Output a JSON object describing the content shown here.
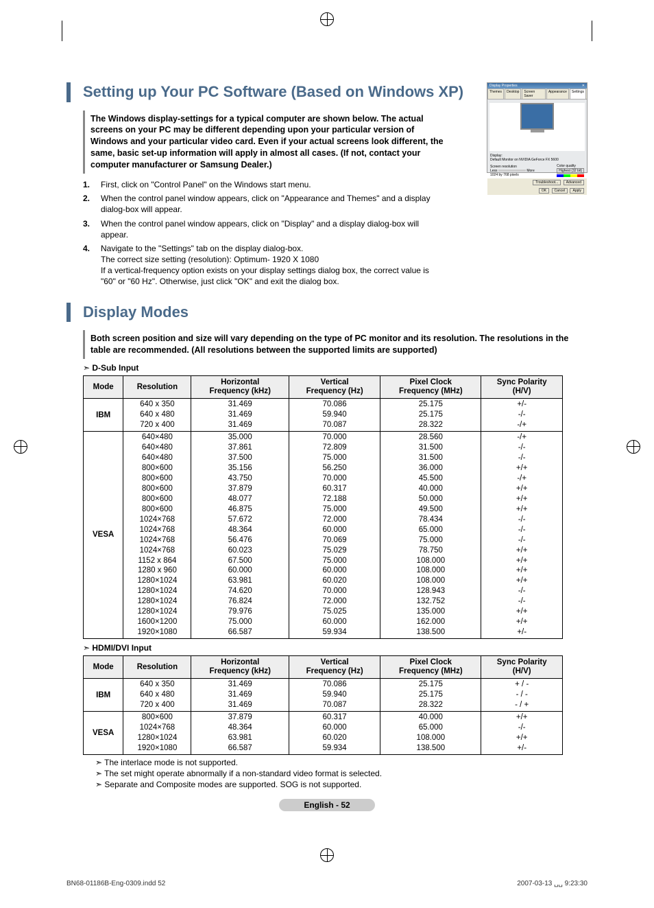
{
  "section1": {
    "title": "Setting up Your PC Software (Based on Windows XP)",
    "lead": "The Windows display-settings for a typical computer are shown below. The actual screens on your PC may be different depending upon your particular version of Windows and your particular video card. Even if your actual screens look different, the same, basic set-up information will apply in almost all cases. (If not, contact your computer manufacturer or Samsung Dealer.)",
    "steps": [
      "First, click on \"Control Panel\" on the Windows start menu.",
      "When the control panel window appears, click on \"Appearance and Themes\" and a display dialog-box will appear.",
      "When the control panel window appears, click on \"Display\" and a display dialog-box will appear.",
      "Navigate to the \"Settings\" tab on the display dialog-box.\nThe correct size setting (resolution): Optimum- 1920 X 1080\nIf a vertical-frequency option exists on your display settings dialog box, the correct value is \"60\" or \"60 Hz\". Otherwise, just click \"OK\" and exit the dialog box."
    ],
    "dialog": {
      "title": "Display Properties",
      "tabs": [
        "Themes",
        "Desktop",
        "Screen Saver",
        "Appearance",
        "Settings"
      ],
      "display_label": "Display:",
      "display_value": "Default Monitor on NVIDIA GeForce FX 5600",
      "res_label": "Screen resolution",
      "color_label": "Color quality",
      "less": "Less",
      "more": "More",
      "color_value": "Highest (32 bit)",
      "res_value": "1024 by 768 pixels",
      "btn_trouble": "Troubleshoot...",
      "btn_adv": "Advanced",
      "btn_ok": "OK",
      "btn_cancel": "Cancel",
      "btn_apply": "Apply"
    }
  },
  "section2": {
    "title": "Display Modes",
    "lead": "Both screen position and size will vary depending on the type of PC monitor and its resolution. The resolutions in the table are recommended. (All resolutions between the supported limits are supported)",
    "sub1": "D-Sub Input",
    "sub2": "HDMI/DVI Input",
    "headers": [
      "Mode",
      "Resolution",
      "Horizontal\nFrequency (kHz)",
      "Vertical\nFrequency (Hz)",
      "Pixel Clock\nFrequency (MHz)",
      "Sync Polarity\n(H/V)"
    ],
    "t1_groups": [
      {
        "mode": "IBM",
        "rows": [
          [
            "640 x 350",
            "31.469",
            "70.086",
            "25.175",
            "+/-"
          ],
          [
            "640 x 480",
            "31.469",
            "59.940",
            "25.175",
            "-/-"
          ],
          [
            "720 x 400",
            "31.469",
            "70.087",
            "28.322",
            "-/+"
          ]
        ]
      },
      {
        "mode": "VESA",
        "rows": [
          [
            "640×480",
            "35.000",
            "70.000",
            "28.560",
            "-/+"
          ],
          [
            "640×480",
            "37.861",
            "72.809",
            "31.500",
            "-/-"
          ],
          [
            "640×480",
            "37.500",
            "75.000",
            "31.500",
            "-/-"
          ],
          [
            "800×600",
            "35.156",
            "56.250",
            "36.000",
            "+/+"
          ],
          [
            "800×600",
            "43.750",
            "70.000",
            "45.500",
            "-/+"
          ],
          [
            "800×600",
            "37.879",
            "60.317",
            "40.000",
            "+/+"
          ],
          [
            "800×600",
            "48.077",
            "72.188",
            "50.000",
            "+/+"
          ],
          [
            "800×600",
            "46.875",
            "75.000",
            "49.500",
            "+/+"
          ],
          [
            "1024×768",
            "57.672",
            "72.000",
            "78.434",
            "-/-"
          ],
          [
            "1024×768",
            "48.364",
            "60.000",
            "65.000",
            "-/-"
          ],
          [
            "1024×768",
            "56.476",
            "70.069",
            "75.000",
            "-/-"
          ],
          [
            "1024×768",
            "60.023",
            "75.029",
            "78.750",
            "+/+"
          ],
          [
            "1152 x 864",
            "67.500",
            "75.000",
            "108.000",
            "+/+"
          ],
          [
            "1280 x 960",
            "60.000",
            "60.000",
            "108.000",
            "+/+"
          ],
          [
            "1280×1024",
            "63.981",
            "60.020",
            "108.000",
            "+/+"
          ],
          [
            "1280×1024",
            "74.620",
            "70.000",
            "128.943",
            "-/-"
          ],
          [
            "1280×1024",
            "76.824",
            "72.000",
            "132.752",
            "-/-"
          ],
          [
            "1280×1024",
            "79.976",
            "75.025",
            "135.000",
            "+/+"
          ],
          [
            "1600×1200",
            "75.000",
            "60.000",
            "162.000",
            "+/+"
          ],
          [
            "1920×1080",
            "66.587",
            "59.934",
            "138.500",
            "+/-"
          ]
        ]
      }
    ],
    "t2_groups": [
      {
        "mode": "IBM",
        "rows": [
          [
            "640 x 350",
            "31.469",
            "70.086",
            "25.175",
            "+ / -"
          ],
          [
            "640 x 480",
            "31.469",
            "59.940",
            "25.175",
            "- / -"
          ],
          [
            "720 x 400",
            "31.469",
            "70.087",
            "28.322",
            "- / +"
          ]
        ]
      },
      {
        "mode": "VESA",
        "rows": [
          [
            "800×600",
            "37.879",
            "60.317",
            "40.000",
            "+/+"
          ],
          [
            "1024×768",
            "48.364",
            "60.000",
            "65.000",
            "-/-"
          ],
          [
            "1280×1024",
            "63.981",
            "60.020",
            "108.000",
            "+/+"
          ],
          [
            "1920×1080",
            "66.587",
            "59.934",
            "138.500",
            "+/-"
          ]
        ]
      }
    ],
    "notes": [
      "The interlace mode is not supported.",
      "The set might operate abnormally if a non-standard video format is selected.",
      "Separate and Composite modes are supported. SOG is not supported."
    ]
  },
  "foot_pill": "English - 52",
  "print_foot_left": "BN68-01186B-Eng-0309.indd   52",
  "print_foot_right": "2007-03-13   ␣␣ 9:23:30"
}
